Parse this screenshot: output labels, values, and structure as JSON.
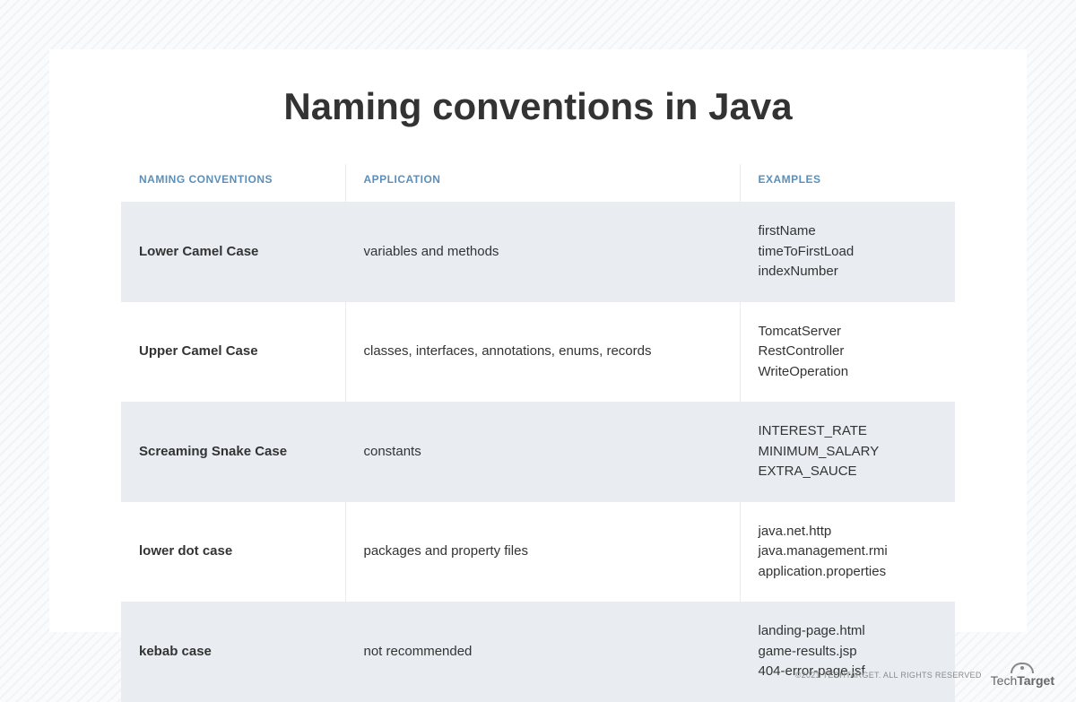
{
  "title": "Naming conventions in Java",
  "headers": {
    "col1": "Naming Conventions",
    "col2": "Application",
    "col3": "Examples"
  },
  "rows": [
    {
      "name": "Lower Camel Case",
      "application": "variables and methods",
      "examples": [
        "firstName",
        "timeToFirstLoad",
        "indexNumber"
      ]
    },
    {
      "name": "Upper Camel Case",
      "application": "classes, interfaces, annotations, enums, records",
      "examples": [
        "TomcatServer",
        "RestController",
        "WriteOperation"
      ]
    },
    {
      "name": "Screaming Snake Case",
      "application": "constants",
      "examples": [
        "INTEREST_RATE",
        "MINIMUM_SALARY",
        "EXTRA_SAUCE"
      ]
    },
    {
      "name": "lower dot case",
      "application": "packages and property files",
      "examples": [
        "java.net.http",
        "java.management.rmi",
        "application.properties"
      ]
    },
    {
      "name": "kebab case",
      "application": "not recommended",
      "examples": [
        "landing-page.html",
        "game-results.jsp",
        "404-error-page.jsf"
      ]
    }
  ],
  "footer": {
    "copyright": "©2021 TECHTARGET. ALL RIGHTS RESERVED",
    "logo_prefix": "Tech",
    "logo_suffix": "Target"
  }
}
